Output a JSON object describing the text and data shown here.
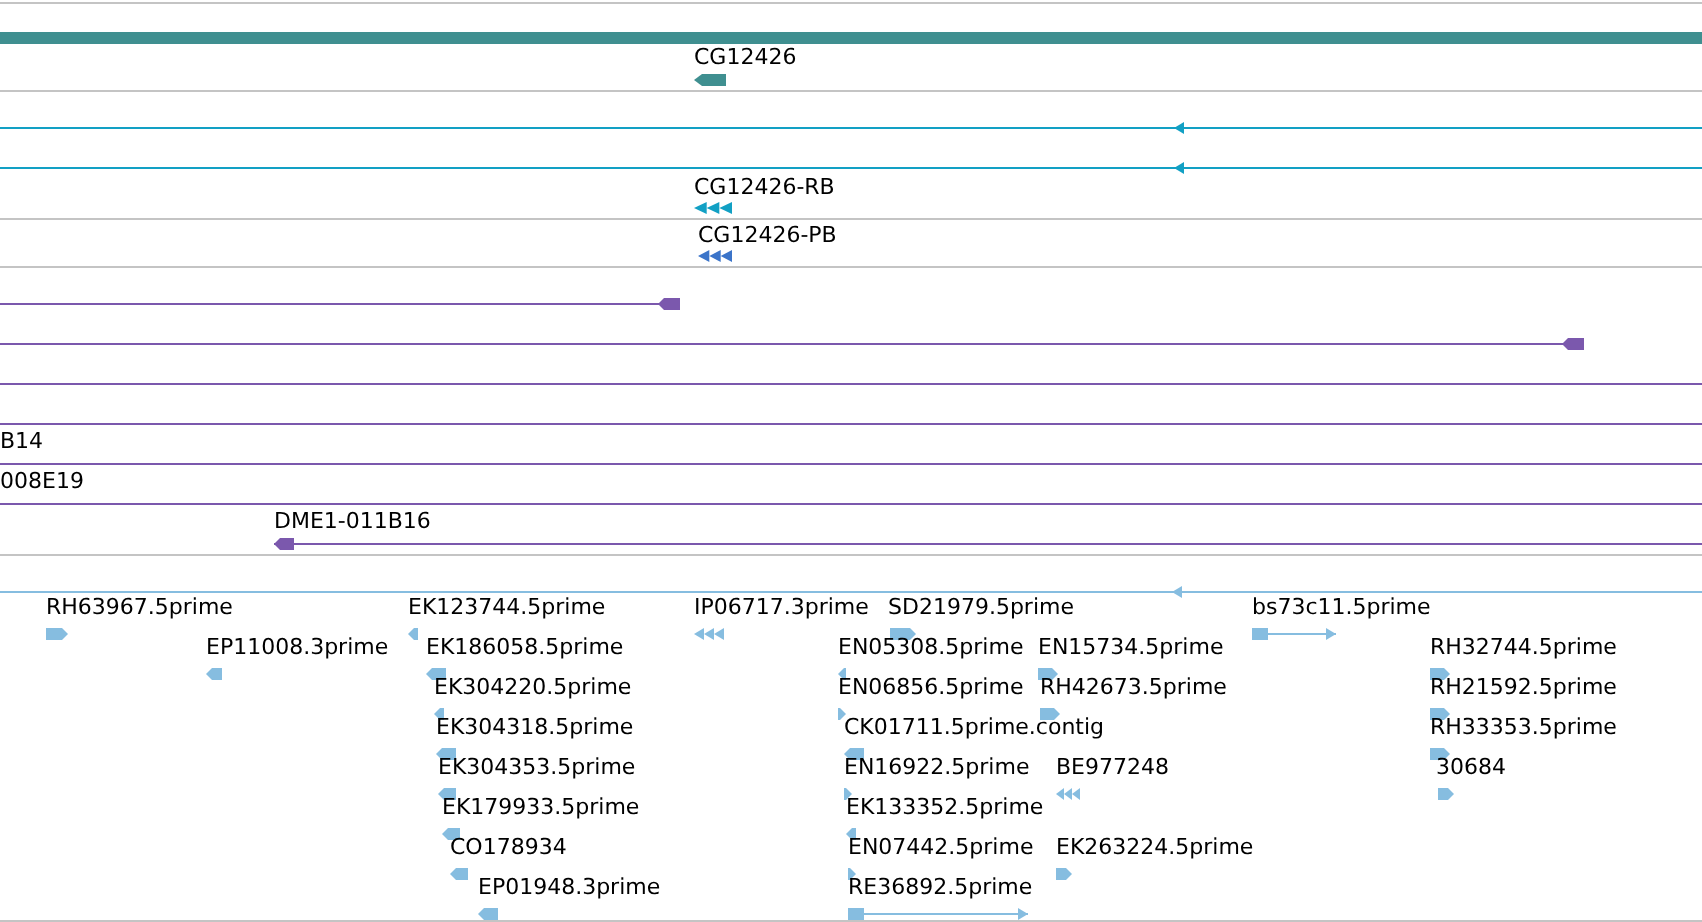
{
  "gene": {
    "label": "CG12426"
  },
  "transcripts": [
    {
      "label": "CG12426-RB",
      "kind": "mrna"
    },
    {
      "label": "CG12426-PB",
      "kind": "protein"
    }
  ],
  "clones": [
    {
      "label": "B14"
    },
    {
      "label": "008E19"
    },
    {
      "label": "DME1-011B16"
    }
  ],
  "ests": [
    {
      "label": "RH63967.5prime",
      "kind": "forward"
    },
    {
      "label": "EK123744.5prime",
      "kind": "reverse"
    },
    {
      "label": "IP06717.3prime",
      "kind": "reverse_exons"
    },
    {
      "label": "SD21979.5prime",
      "kind": "forward"
    },
    {
      "label": "bs73c11.5prime",
      "kind": "forward_span"
    },
    {
      "label": "EP11008.3prime",
      "kind": "reverse"
    },
    {
      "label": "EK186058.5prime",
      "kind": "reverse"
    },
    {
      "label": "EN05308.5prime",
      "kind": "reverse"
    },
    {
      "label": "EN15734.5prime",
      "kind": "forward"
    },
    {
      "label": "RH32744.5prime",
      "kind": "forward"
    },
    {
      "label": "EK304220.5prime",
      "kind": "reverse"
    },
    {
      "label": "EN06856.5prime",
      "kind": "forward"
    },
    {
      "label": "RH42673.5prime",
      "kind": "forward"
    },
    {
      "label": "RH21592.5prime",
      "kind": "forward"
    },
    {
      "label": "EK304318.5prime",
      "kind": "reverse"
    },
    {
      "label": "CK01711.5prime.contig",
      "kind": "reverse"
    },
    {
      "label": "RH33353.5prime",
      "kind": "forward"
    },
    {
      "label": "EK304353.5prime",
      "kind": "reverse"
    },
    {
      "label": "EN16922.5prime",
      "kind": "forward"
    },
    {
      "label": "BE977248",
      "kind": "reverse_exons"
    },
    {
      "label": "30684",
      "kind": "forward"
    },
    {
      "label": "EK179933.5prime",
      "kind": "reverse"
    },
    {
      "label": "EK133352.5prime",
      "kind": "reverse"
    },
    {
      "label": "CO178934",
      "kind": "reverse"
    },
    {
      "label": "EN07442.5prime",
      "kind": "forward"
    },
    {
      "label": "EK263224.5prime",
      "kind": "forward"
    },
    {
      "label": "EP01948.3prime",
      "kind": "reverse"
    },
    {
      "label": "RE36892.5prime",
      "kind": "forward_span"
    }
  ]
}
